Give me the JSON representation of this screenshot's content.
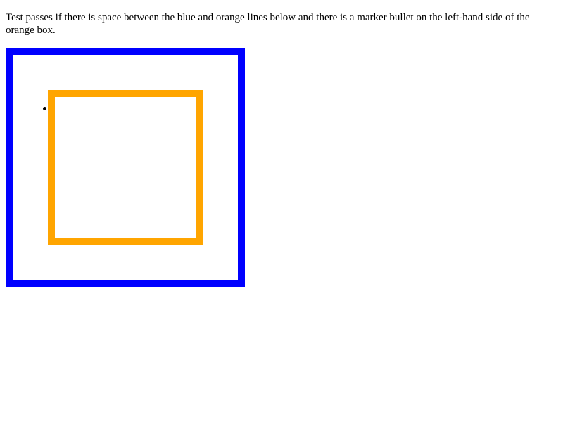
{
  "instructions": "Test passes if there is space between the blue and orange lines below and there is a marker bullet on the left-hand side of the orange box.",
  "colors": {
    "outer_border": "#0000ff",
    "inner_border": "#ffa500",
    "marker": "#000000",
    "background": "#ffffff"
  }
}
